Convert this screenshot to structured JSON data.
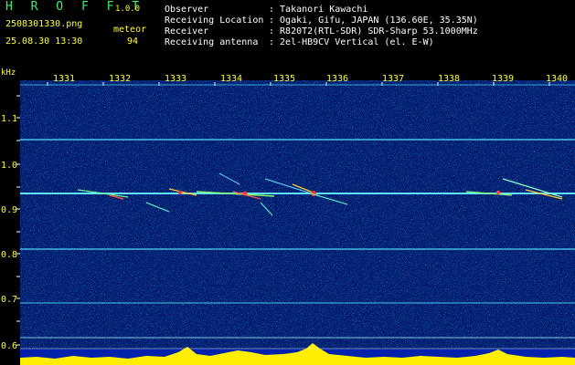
{
  "app": {
    "name": "H R O F F T",
    "version": "1.0.0"
  },
  "file": {
    "name": "2508301330.png",
    "datetime": "25.08.30 13:30"
  },
  "meteor": {
    "label": "meteor",
    "count": "94"
  },
  "info": [
    {
      "label": "Observer",
      "value": ": Takanori Kawachi"
    },
    {
      "label": "Receiving Location",
      "value": ": Ogaki, Gifu, JAPAN (136.60E, 35.35N)"
    },
    {
      "label": "Receiver",
      "value": ": R820T2(RTL-SDR) SDR-Sharp 53.1000MHz"
    },
    {
      "label": "Receiving antenna",
      "value": ": 2el-HB9CV Vertical (el. E-W)"
    }
  ],
  "axis": {
    "unit": "kHz",
    "time_ticks": [
      "1331",
      "1332",
      "1333",
      "1334",
      "1335",
      "1336",
      "1337",
      "1338",
      "1339",
      "1340"
    ],
    "freq_ticks": [
      "1.1",
      "1.0",
      "0.9",
      "0.8",
      "0.7",
      "0.6"
    ]
  },
  "colors": {
    "background": "#000000",
    "plot_bg": "#001a6a",
    "carrier": "#55ddff",
    "meteor": "#ff4444",
    "header_text": "#ffff33"
  }
}
